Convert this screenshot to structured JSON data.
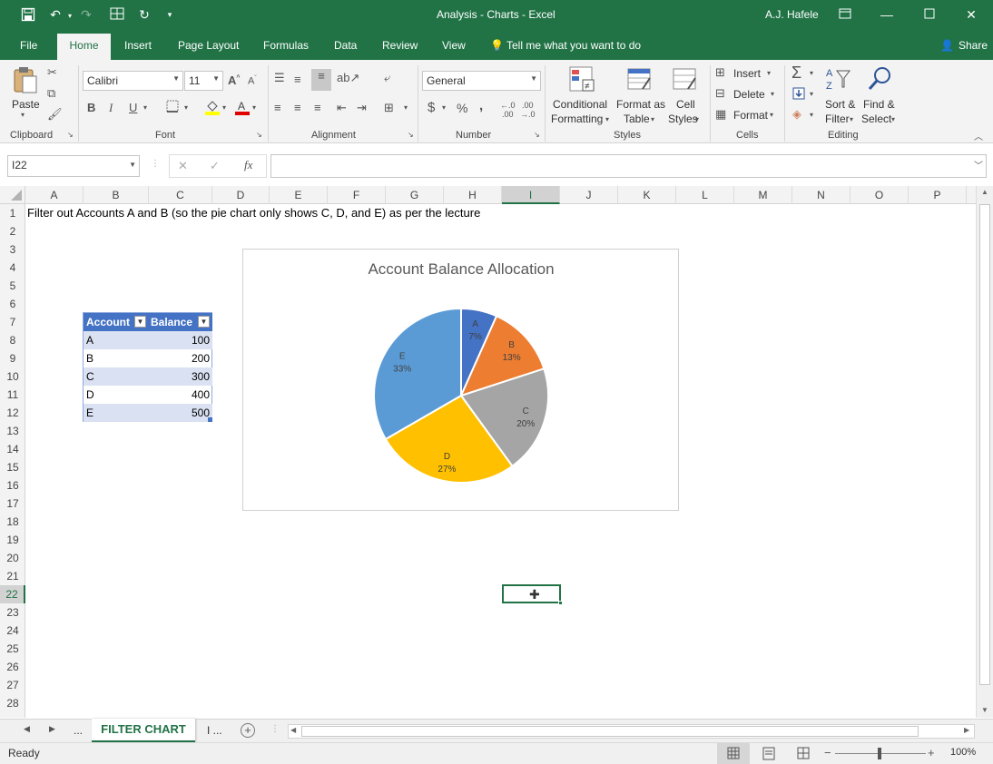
{
  "window": {
    "title": "Analysis - Charts  -  Excel",
    "user": "A.J. Hafele"
  },
  "ribbon_tabs": [
    "File",
    "Home",
    "Insert",
    "Page Layout",
    "Formulas",
    "Data",
    "Review",
    "View"
  ],
  "tell_me": "Tell me what you want to do",
  "share": "Share",
  "ribbon": {
    "clipboard": {
      "paste": "Paste",
      "label": "Clipboard"
    },
    "font": {
      "name": "Calibri",
      "size": "11",
      "label": "Font",
      "bold": "B",
      "italic": "I",
      "underline": "U"
    },
    "alignment": {
      "label": "Alignment"
    },
    "number": {
      "format": "General",
      "label": "Number",
      "currency": "$",
      "percent": "%",
      "comma": ","
    },
    "styles": {
      "conditional_1": "Conditional",
      "conditional_2": "Formatting",
      "format_as_1": "Format as",
      "format_as_2": "Table",
      "cell_1": "Cell",
      "cell_2": "Styles",
      "label": "Styles"
    },
    "cells": {
      "insert": "Insert",
      "delete": "Delete",
      "format": "Format",
      "label": "Cells"
    },
    "editing": {
      "sort_1": "Sort &",
      "sort_2": "Filter",
      "find_1": "Find &",
      "find_2": "Select",
      "label": "Editing"
    }
  },
  "formula_bar": {
    "name_box": "I22",
    "fx": "fx",
    "value": ""
  },
  "columns": [
    "A",
    "B",
    "C",
    "D",
    "E",
    "F",
    "G",
    "H",
    "I",
    "J",
    "K",
    "L",
    "M",
    "N",
    "O",
    "P"
  ],
  "rows": [
    "1",
    "2",
    "3",
    "4",
    "5",
    "6",
    "7",
    "8",
    "9",
    "10",
    "11",
    "12",
    "13",
    "14",
    "15",
    "16",
    "17",
    "18",
    "19",
    "20",
    "21",
    "22",
    "23",
    "24",
    "25",
    "26",
    "27",
    "28"
  ],
  "cell_a1": "Filter out Accounts A and B (so the pie chart only shows C, D, and E) as per the lecture",
  "table": {
    "headers": [
      "Account",
      "Balance"
    ],
    "rows": [
      [
        "A",
        "100"
      ],
      [
        "B",
        "200"
      ],
      [
        "C",
        "300"
      ],
      [
        "D",
        "400"
      ],
      [
        "E",
        "500"
      ]
    ],
    "header_color": "#4472c4",
    "band_color": "#d9e1f2"
  },
  "chart_data": {
    "type": "pie",
    "title": "Account Balance Allocation",
    "slices": [
      {
        "label": "A",
        "value": 100,
        "percent": "7%",
        "color": "#4472c4"
      },
      {
        "label": "B",
        "value": 200,
        "percent": "13%",
        "color": "#ed7d31"
      },
      {
        "label": "C",
        "value": 300,
        "percent": "20%",
        "color": "#a5a5a5"
      },
      {
        "label": "D",
        "value": 400,
        "percent": "27%",
        "color": "#ffc000"
      },
      {
        "label": "E",
        "value": 500,
        "percent": "33%",
        "color": "#5b9bd5"
      }
    ]
  },
  "sheet_tabs": {
    "ellipsis_left": "...",
    "active": "FILTER CHART",
    "next": "I ..."
  },
  "status": {
    "ready": "Ready",
    "zoom": "100%"
  },
  "colors": {
    "excel_green": "#217346",
    "selection": "#217346"
  }
}
